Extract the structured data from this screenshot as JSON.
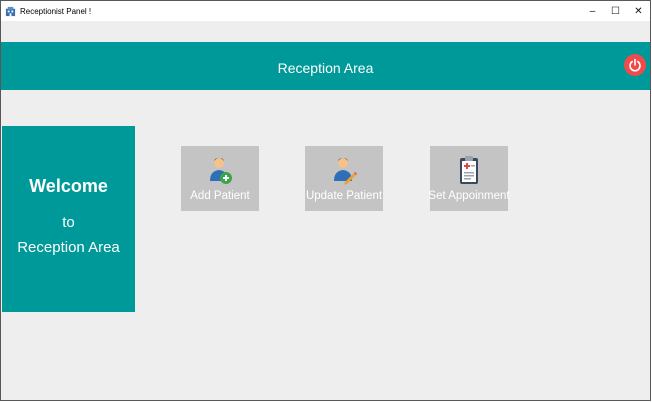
{
  "window": {
    "title": "Receptionist Panel !",
    "icons": {
      "app": "app-icon",
      "minimize": "minimize-icon",
      "maximize": "maximize-icon",
      "close": "close-icon"
    },
    "controls": {
      "minimize": "–",
      "maximize": "☐",
      "close": "✕"
    }
  },
  "header": {
    "title": "Reception Area",
    "power_icon": "power-icon",
    "accent_color": "#009999",
    "power_color": "#f04a4a"
  },
  "welcome": {
    "title": "Welcome",
    "connector": "to",
    "subtitle": "Reception Area"
  },
  "tiles": [
    {
      "label": "Add Patient",
      "icon": "add-patient-icon"
    },
    {
      "label": "Update Patient",
      "icon": "update-patient-icon"
    },
    {
      "label": "Set Appoinment",
      "icon": "clipboard-icon"
    }
  ]
}
